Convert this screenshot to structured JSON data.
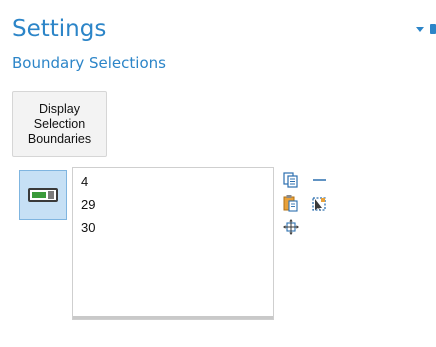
{
  "header": {
    "title": "Settings",
    "subtitle": "Boundary Selections"
  },
  "actions": {
    "display_button_label": "Display Selection Boundaries"
  },
  "selection_list": {
    "items": [
      "4",
      "29",
      "30"
    ]
  },
  "colors": {
    "accent": "#2c85c8",
    "toggle_active_bg": "#c6e0f5",
    "list_border": "#cfcfcf"
  },
  "icons": {
    "header": [
      "dropdown-caret-icon",
      "pin-icon"
    ],
    "tools": [
      "copy-list-icon",
      "clear-selection-icon",
      "paste-icon",
      "zoom-to-selection-icon",
      "move-selection-icon"
    ],
    "toggle": "activate-selection-toggle-icon"
  }
}
